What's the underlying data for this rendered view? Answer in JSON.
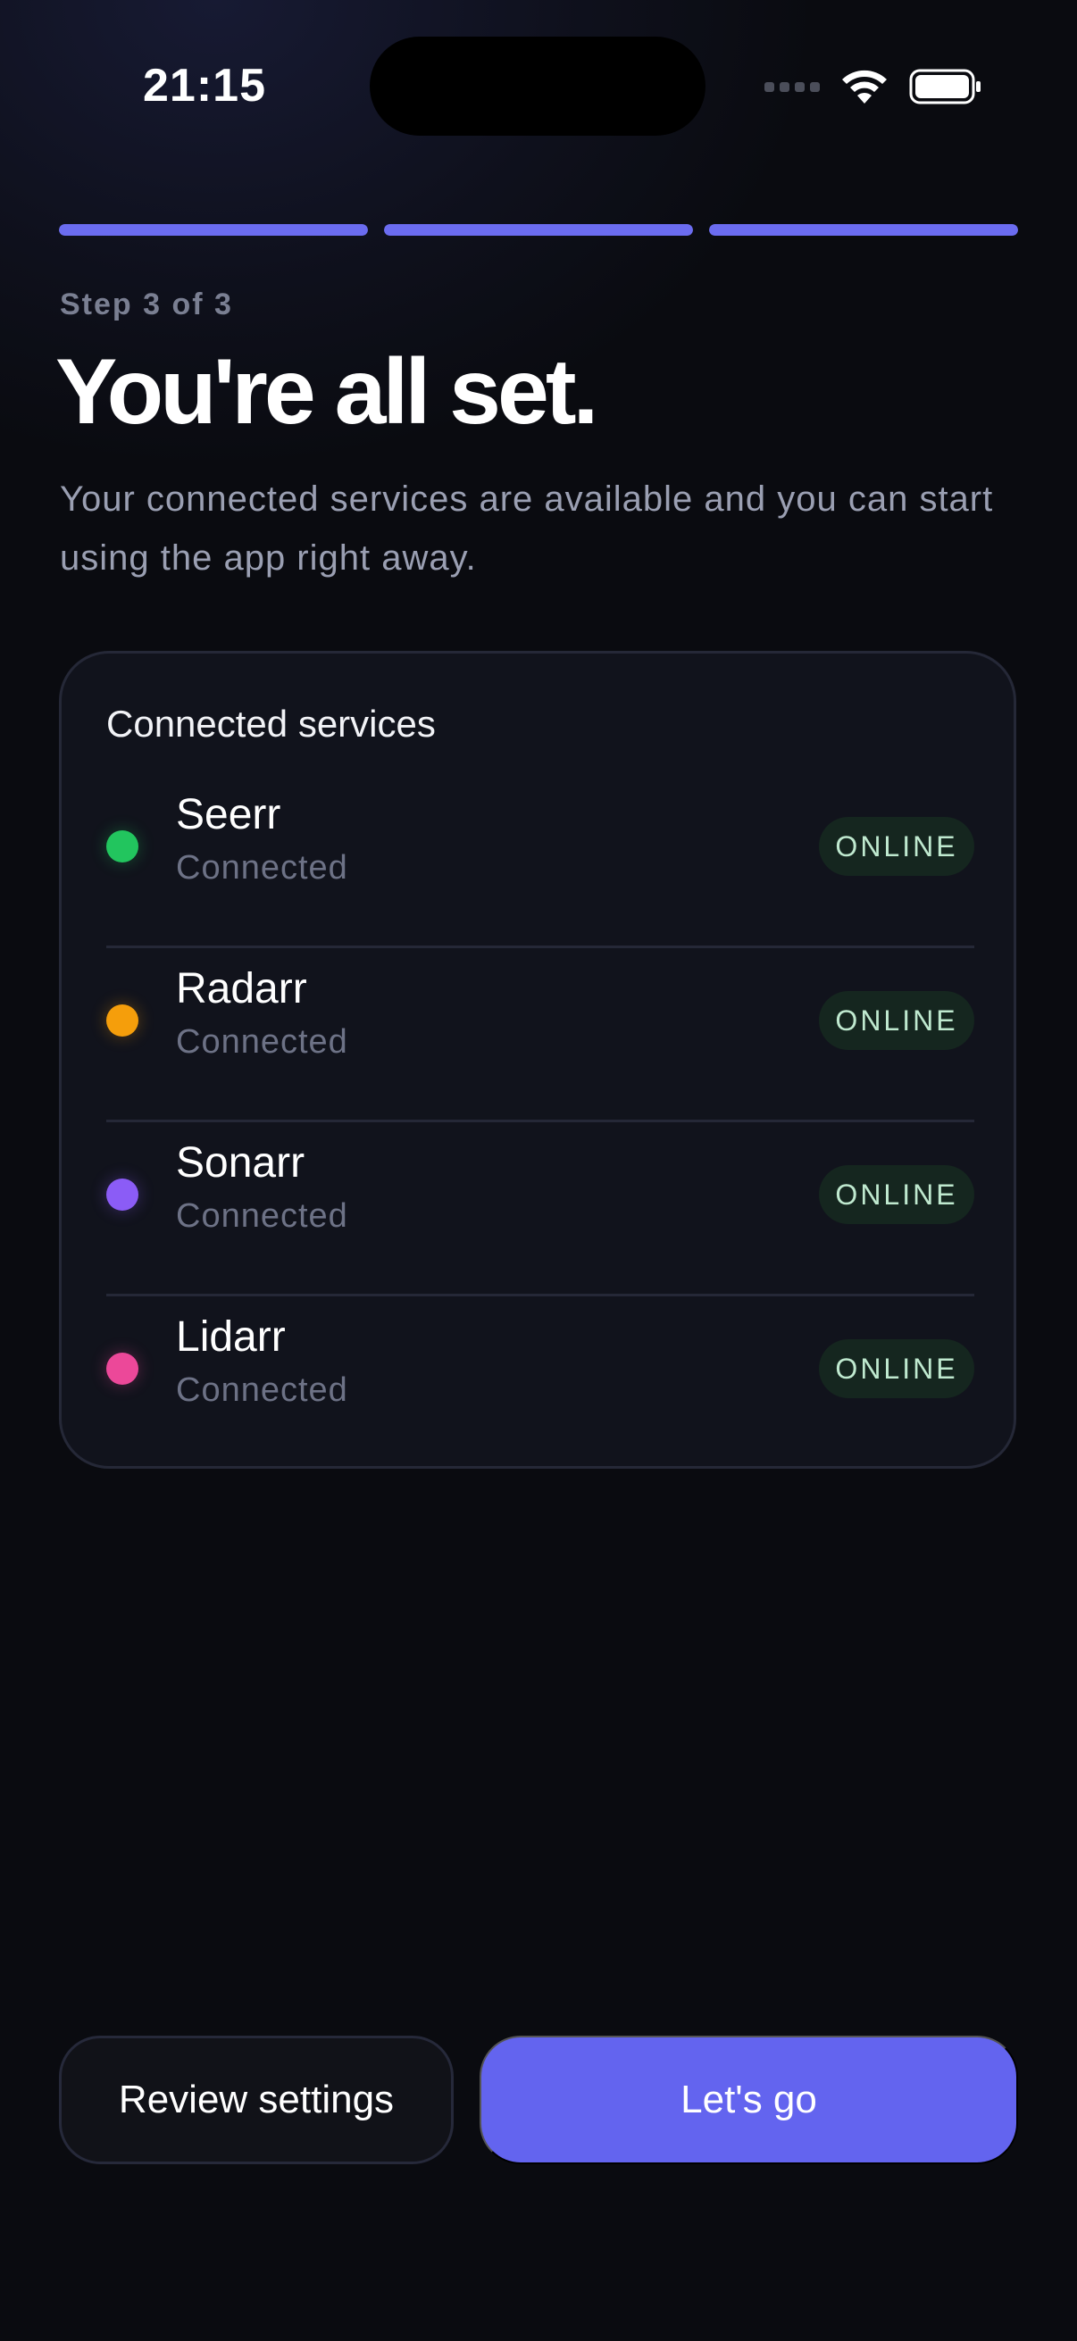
{
  "status_bar": {
    "time": "21:15",
    "icons": [
      "cellular-signal-icon",
      "wifi-icon",
      "battery-icon"
    ]
  },
  "progress": {
    "total_steps": 3,
    "completed_steps": 3,
    "color": "#6b6cf0"
  },
  "header": {
    "step_label": "Step 3 of 3",
    "title": "You're all set.",
    "subtitle": "Your connected services are available and you can start using the app right away."
  },
  "services_card": {
    "title": "Connected services",
    "items": [
      {
        "name": "Seerr",
        "status": "Connected",
        "badge": "ONLINE",
        "dot_color": "#22c55e"
      },
      {
        "name": "Radarr",
        "status": "Connected",
        "badge": "ONLINE",
        "dot_color": "#f59e0b"
      },
      {
        "name": "Sonarr",
        "status": "Connected",
        "badge": "ONLINE",
        "dot_color": "#8b5cf6"
      },
      {
        "name": "Lidarr",
        "status": "Connected",
        "badge": "ONLINE",
        "dot_color": "#ec4899"
      }
    ]
  },
  "actions": {
    "secondary_label": "Review settings",
    "primary_label": "Let's go",
    "primary_color": "#6364ef"
  }
}
